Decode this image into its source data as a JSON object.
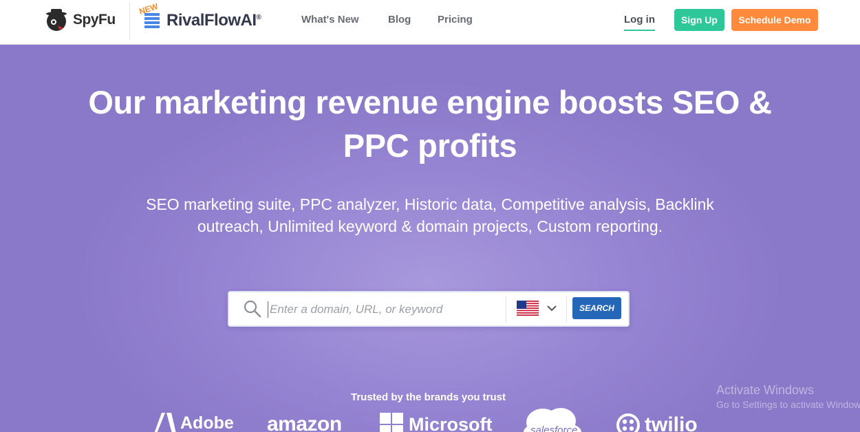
{
  "header": {
    "spyfu_logo": "SpyFu",
    "rivalflow_badge": "NEW",
    "rivalflow_logo": "RivalFlowAI",
    "rivalflow_reg": "®",
    "nav": [
      "What's New",
      "Blog",
      "Pricing"
    ],
    "login": "Log in",
    "signup": "Sign Up",
    "demo": "Schedule Demo"
  },
  "hero": {
    "title": "Our marketing revenue engine boosts SEO & PPC profits",
    "subtitle": "SEO marketing suite, PPC analyzer, Historic data, Competitive analysis, Backlink outreach, Unlimited keyword & domain projects, Custom reporting."
  },
  "search": {
    "placeholder": "Enter a domain, URL, or keyword",
    "country_icon": "us-flag-icon",
    "button": "SEARCH"
  },
  "trusted": {
    "heading": "Trusted by the brands you trust",
    "brands": [
      "Adobe",
      "amazon",
      "Microsoft",
      "salesforce",
      "twilio"
    ]
  },
  "watermark": {
    "line1": "Activate Windows",
    "line2": "Go to Settings to activate Windows."
  },
  "colors": {
    "accent_green": "#2ec79a",
    "accent_orange": "#ff8a3c",
    "hero_purple": "#9685d3",
    "search_blue": "#2466b7"
  }
}
